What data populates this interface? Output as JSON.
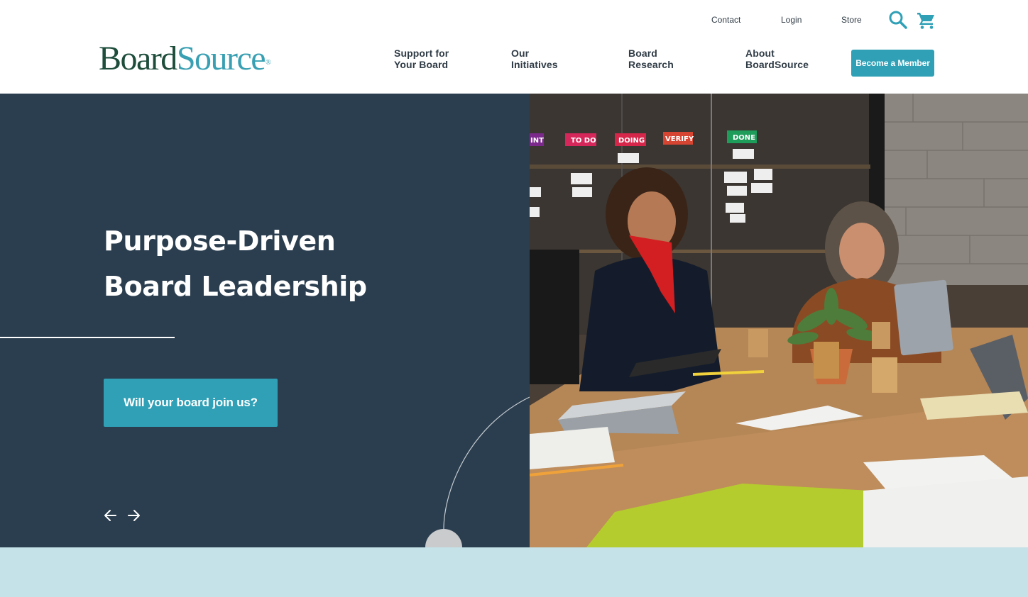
{
  "brand": {
    "logo_part1": "Board",
    "logo_part2": "Source",
    "logo_mark": "®",
    "primary_color": "#1e4d3c",
    "accent_color": "#2fa0b6"
  },
  "utility_nav": {
    "contact": "Contact",
    "login": "Login",
    "store": "Store",
    "search_icon": "search-icon",
    "cart_icon": "cart-icon"
  },
  "main_nav": [
    {
      "line1": "Support for",
      "line2": "Your Board"
    },
    {
      "line1": "Our",
      "line2": "Initiatives"
    },
    {
      "line1": "Board",
      "line2": "Research"
    },
    {
      "line1": "About",
      "line2": "BoardSource"
    }
  ],
  "member_button": "Become a Member",
  "hero": {
    "title": "Purpose-Driven Board Leadership",
    "cta": "Will your board join us?",
    "background_color": "#2b3e4f",
    "prev_icon": "arrow-left-icon",
    "next_icon": "arrow-right-icon"
  },
  "photo": {
    "board_labels": [
      "INT",
      "TO DO",
      "DOING",
      "VERIFY",
      "DONE"
    ]
  },
  "band_color": "#c4e2e8"
}
